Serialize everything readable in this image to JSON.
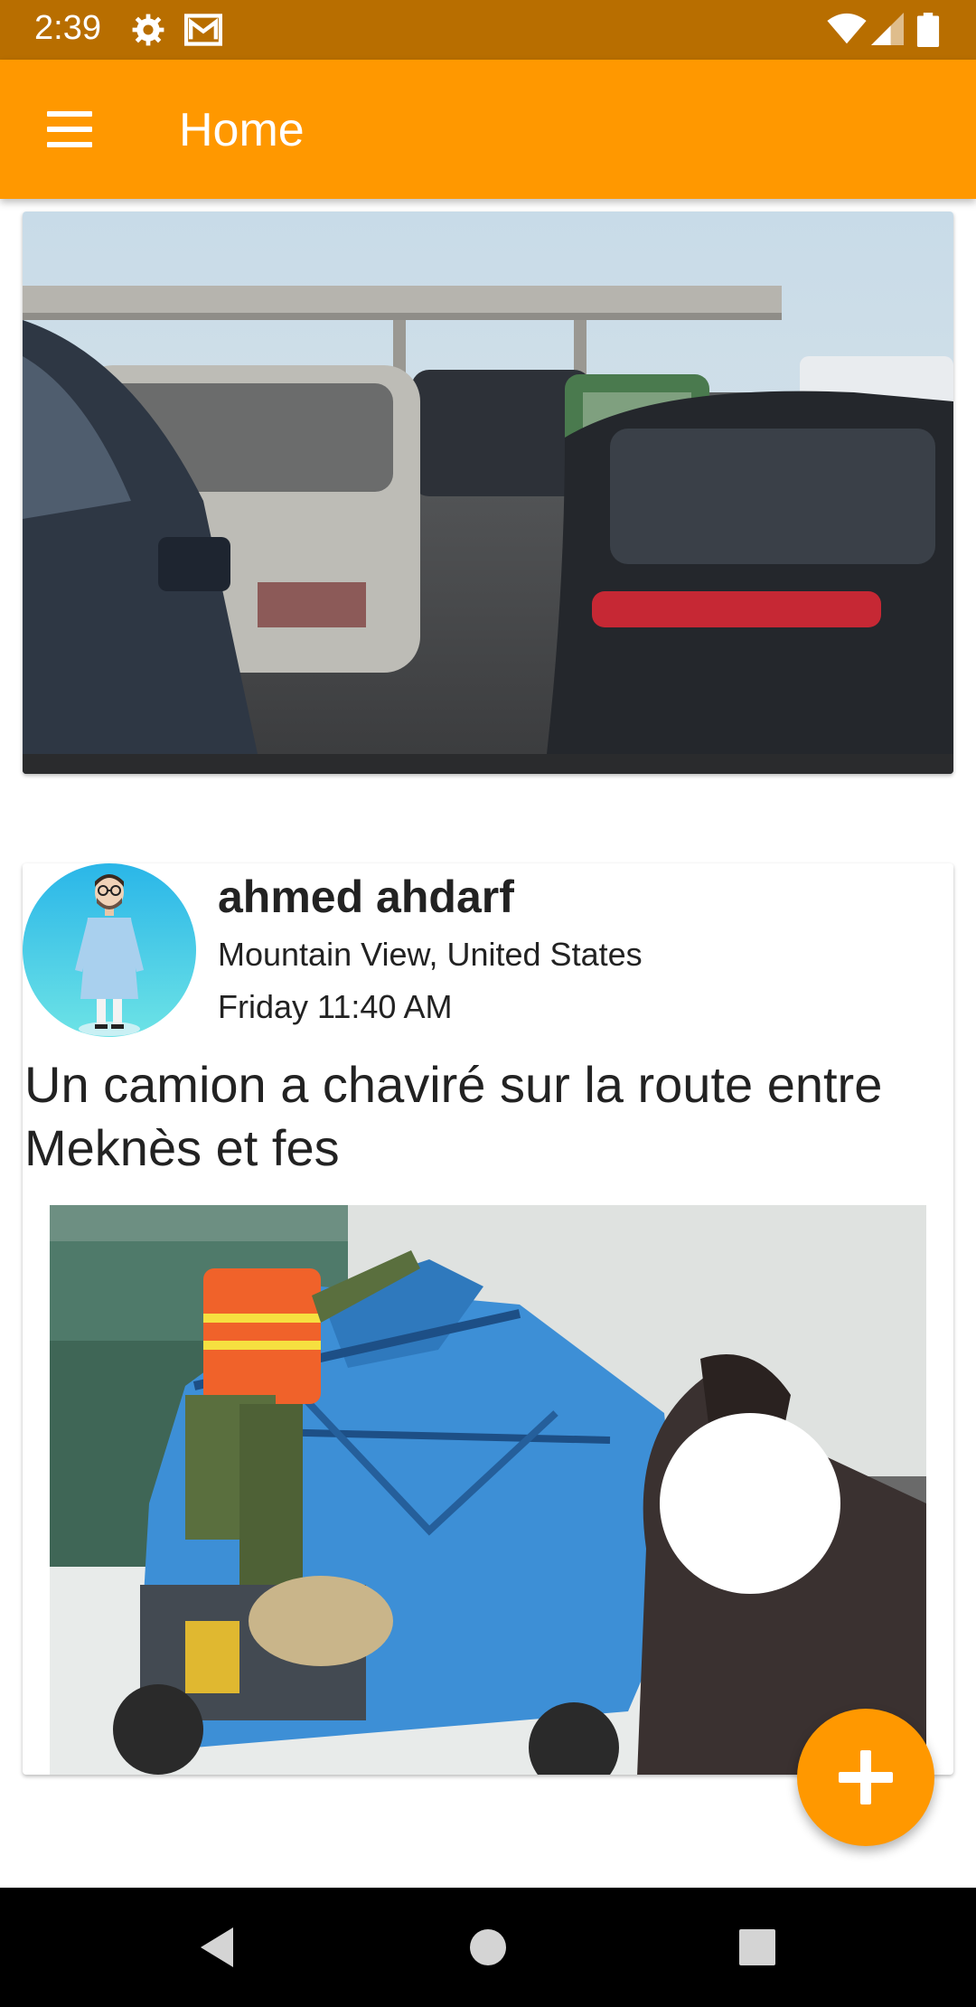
{
  "status_bar": {
    "time": "2:39",
    "icons": [
      "gear-icon",
      "mail-icon",
      "wifi-icon",
      "signal-icon",
      "battery-icon"
    ]
  },
  "app_bar": {
    "title": "Home",
    "menu_icon": "hamburger-menu-icon",
    "color": "#ff9800"
  },
  "feed": {
    "cards": [
      {
        "image_alt": "traffic-jam-photo"
      },
      {
        "author_name": "ahmed ahdarf",
        "location": "Mountain View, United States",
        "time": "Friday 11:40 AM",
        "text": "Un camion a chaviré sur la route entre Meknès et fes",
        "image_alt": "overturned-truck-photo"
      }
    ]
  },
  "fab": {
    "icon": "plus-icon"
  },
  "nav_bar": {
    "icons": [
      "back-icon",
      "home-icon",
      "recents-icon"
    ]
  },
  "colors": {
    "accent": "#ff9800",
    "status_bar": "#b86e00"
  }
}
